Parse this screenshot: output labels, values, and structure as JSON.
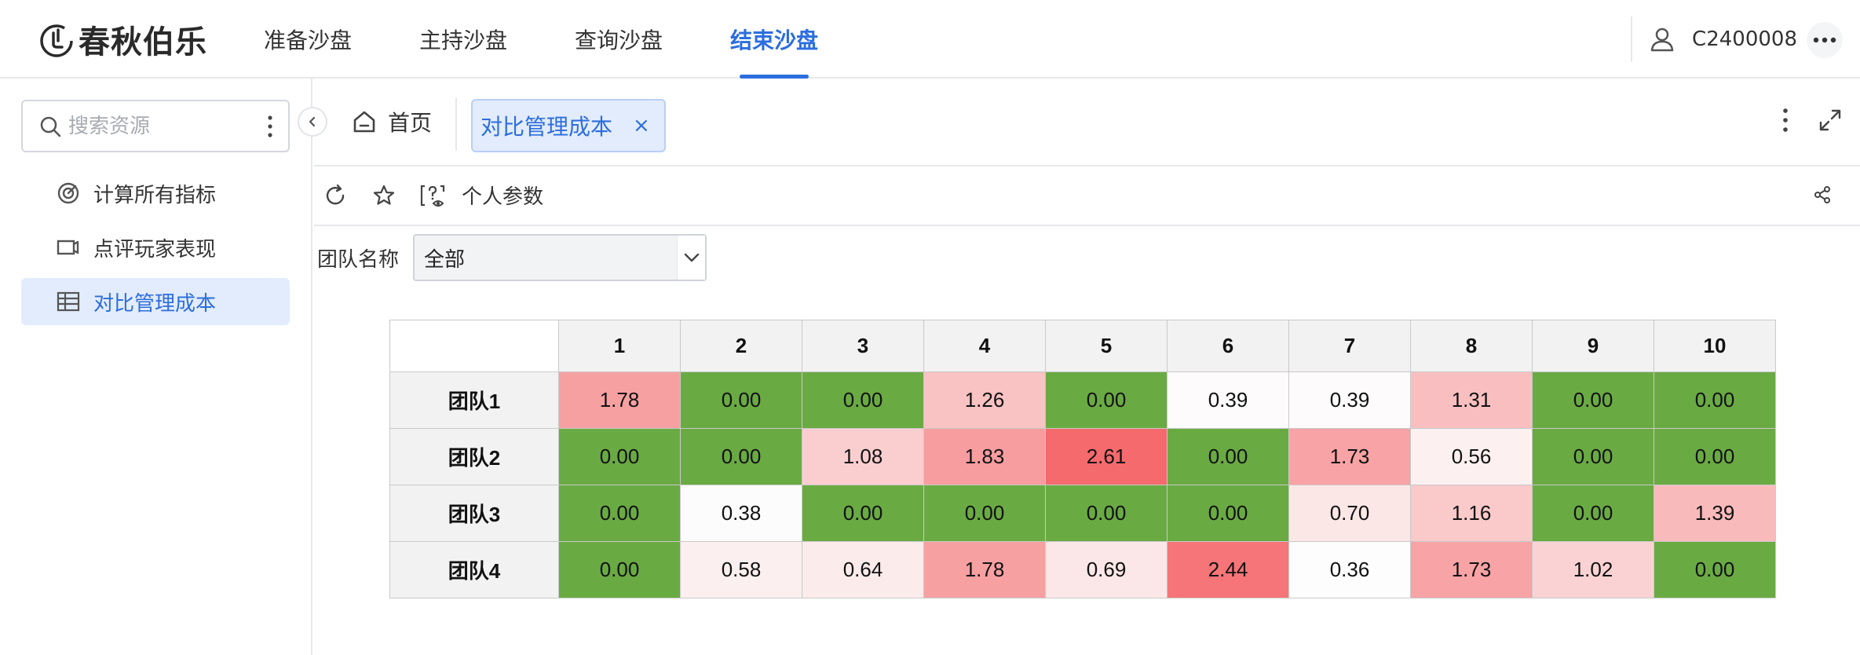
{
  "app": {
    "logo_text": "春秋伯乐"
  },
  "nav": {
    "items": [
      {
        "label": "准备沙盘",
        "active": false
      },
      {
        "label": "主持沙盘",
        "active": false
      },
      {
        "label": "查询沙盘",
        "active": false
      },
      {
        "label": "结束沙盘",
        "active": true
      }
    ]
  },
  "user": {
    "name": "C2400008"
  },
  "sidebar": {
    "search_placeholder": "搜索资源",
    "items": [
      {
        "label": "计算所有指标",
        "icon": "gauge-icon",
        "active": false
      },
      {
        "label": "点评玩家表现",
        "icon": "comment-box-icon",
        "active": false
      },
      {
        "label": "对比管理成本",
        "icon": "table-icon",
        "active": true
      }
    ]
  },
  "tabs": {
    "home_label": "首页",
    "active_label": "对比管理成本",
    "close_symbol": "×"
  },
  "toolbar": {
    "params_label": "个人参数"
  },
  "filter": {
    "label": "团队名称",
    "value": "全部"
  },
  "colors": {
    "accent": "#2c6ede",
    "zero": "#6aaa43",
    "heat_max": "#f46a6d",
    "heat_min": "#fdfdfd"
  },
  "chart_data": {
    "type": "heatmap",
    "columns": [
      "1",
      "2",
      "3",
      "4",
      "5",
      "6",
      "7",
      "8",
      "9",
      "10"
    ],
    "rows": [
      "团队1",
      "团队2",
      "团队3",
      "团队4"
    ],
    "values": [
      [
        "1.78",
        "0.00",
        "0.00",
        "1.26",
        "0.00",
        "0.39",
        "0.39",
        "1.31",
        "0.00",
        "0.00"
      ],
      [
        "0.00",
        "0.00",
        "1.08",
        "1.83",
        "2.61",
        "0.00",
        "1.73",
        "0.56",
        "0.00",
        "0.00"
      ],
      [
        "0.00",
        "0.38",
        "0.00",
        "0.00",
        "0.00",
        "0.00",
        "0.70",
        "1.16",
        "0.00",
        "1.39"
      ],
      [
        "0.00",
        "0.58",
        "0.64",
        "1.78",
        "0.69",
        "2.44",
        "0.36",
        "1.73",
        "1.02",
        "0.00"
      ]
    ]
  }
}
